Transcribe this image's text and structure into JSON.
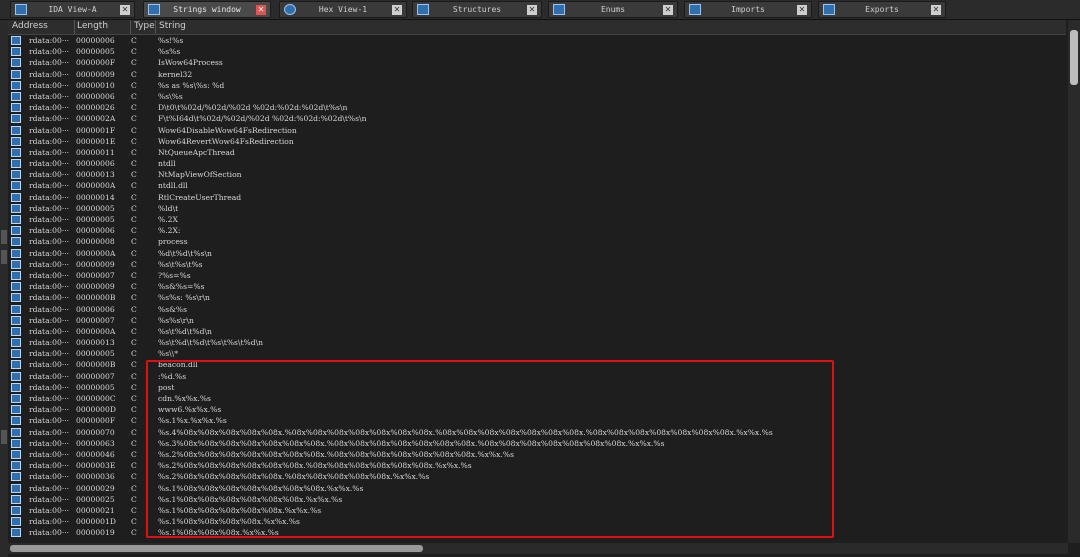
{
  "tabs": [
    {
      "label": "IDA View-A",
      "close": "✕",
      "active": false
    },
    {
      "label": "Strings window",
      "close": "✕",
      "active": true
    },
    {
      "label": "Hex View-1",
      "close": "✕",
      "active": false
    },
    {
      "label": "Structures",
      "close": "✕",
      "active": false
    },
    {
      "label": "Enums",
      "close": "✕",
      "active": false
    },
    {
      "label": "Imports",
      "close": "✕",
      "active": false
    },
    {
      "label": "Exports",
      "close": "✕",
      "active": false
    }
  ],
  "columns": {
    "address": "Address",
    "length": "Length",
    "type": "Type",
    "string": "String"
  },
  "rows": [
    {
      "address": "rdata:00···",
      "length": "00000006",
      "type": "C",
      "string": "%s!%s"
    },
    {
      "address": "rdata:00···",
      "length": "00000005",
      "type": "C",
      "string": "%s%s"
    },
    {
      "address": "rdata:00···",
      "length": "0000000F",
      "type": "C",
      "string": "IsWow64Process"
    },
    {
      "address": "rdata:00···",
      "length": "00000009",
      "type": "C",
      "string": "kernel32"
    },
    {
      "address": "rdata:00···",
      "length": "00000010",
      "type": "C",
      "string": "%s as %s\\%s: %d"
    },
    {
      "address": "rdata:00···",
      "length": "00000006",
      "type": "C",
      "string": "%s\\%s"
    },
    {
      "address": "rdata:00···",
      "length": "00000026",
      "type": "C",
      "string": "D\\t0\\t%02d/%02d/%02d %02d:%02d:%02d\\t%s\\n"
    },
    {
      "address": "rdata:00···",
      "length": "0000002A",
      "type": "C",
      "string": "F\\t%I64d\\t%02d/%02d/%02d %02d:%02d:%02d\\t%s\\n"
    },
    {
      "address": "rdata:00···",
      "length": "0000001F",
      "type": "C",
      "string": "Wow64DisableWow64FsRedirection"
    },
    {
      "address": "rdata:00···",
      "length": "0000001E",
      "type": "C",
      "string": "Wow64RevertWow64FsRedirection"
    },
    {
      "address": "rdata:00···",
      "length": "00000011",
      "type": "C",
      "string": "NtQueueApcThread"
    },
    {
      "address": "rdata:00···",
      "length": "00000006",
      "type": "C",
      "string": "ntdll"
    },
    {
      "address": "rdata:00···",
      "length": "00000013",
      "type": "C",
      "string": "NtMapViewOfSection"
    },
    {
      "address": "rdata:00···",
      "length": "0000000A",
      "type": "C",
      "string": "ntdll.dll"
    },
    {
      "address": "rdata:00···",
      "length": "00000014",
      "type": "C",
      "string": "RtlCreateUserThread"
    },
    {
      "address": "rdata:00···",
      "length": "00000005",
      "type": "C",
      "string": "%ld\\t"
    },
    {
      "address": "rdata:00···",
      "length": "00000005",
      "type": "C",
      "string": "%.2X"
    },
    {
      "address": "rdata:00···",
      "length": "00000006",
      "type": "C",
      "string": "%.2X:"
    },
    {
      "address": "rdata:00···",
      "length": "00000008",
      "type": "C",
      "string": "process"
    },
    {
      "address": "rdata:00···",
      "length": "0000000A",
      "type": "C",
      "string": "%d\\t%d\\t%s\\n"
    },
    {
      "address": "rdata:00···",
      "length": "00000009",
      "type": "C",
      "string": "%s\\t%s\\t%s"
    },
    {
      "address": "rdata:00···",
      "length": "00000007",
      "type": "C",
      "string": "?%s=%s"
    },
    {
      "address": "rdata:00···",
      "length": "00000009",
      "type": "C",
      "string": "%s&%s=%s"
    },
    {
      "address": "rdata:00···",
      "length": "0000000B",
      "type": "C",
      "string": "%s%s: %s\\r\\n"
    },
    {
      "address": "rdata:00···",
      "length": "00000006",
      "type": "C",
      "string": "%s&%s"
    },
    {
      "address": "rdata:00···",
      "length": "00000007",
      "type": "C",
      "string": "%s%s\\r\\n"
    },
    {
      "address": "rdata:00···",
      "length": "0000000A",
      "type": "C",
      "string": "%s\\t%d\\t%d\\n"
    },
    {
      "address": "rdata:00···",
      "length": "00000013",
      "type": "C",
      "string": "%s\\t%d\\t%d\\t%s\\t%s\\t%d\\n"
    },
    {
      "address": "rdata:00···",
      "length": "00000005",
      "type": "C",
      "string": "%s\\\\*"
    },
    {
      "address": "rdata:00···",
      "length": "0000000B",
      "type": "C",
      "string": "beacon.dll"
    },
    {
      "address": "rdata:00···",
      "length": "00000007",
      "type": "C",
      "string": ":%d.%s"
    },
    {
      "address": "rdata:00···",
      "length": "00000005",
      "type": "C",
      "string": "post"
    },
    {
      "address": "rdata:00···",
      "length": "0000000C",
      "type": "C",
      "string": "cdn.%x%x.%s"
    },
    {
      "address": "rdata:00···",
      "length": "0000000D",
      "type": "C",
      "string": "www6.%x%x.%s"
    },
    {
      "address": "rdata:00···",
      "length": "0000000F",
      "type": "C",
      "string": "%s.1%x.%x%x.%s"
    },
    {
      "address": "rdata:00···",
      "length": "00000070",
      "type": "C",
      "string": "%s.4%08x%08x%08x%08x%08x.%08x%08x%08x%08x%08x%08x%08x.%08x%08x%08x%08x%08x%08x%08x.%08x%08x%08x%08x%08x%08x%08x.%x%x.%s"
    },
    {
      "address": "rdata:00···",
      "length": "00000063",
      "type": "C",
      "string": "%s.3%08x%08x%08x%08x%08x%08x%08x.%08x%08x%08x%08x%08x%08x%08x.%08x%08x%08x%08x%08x%08x%08x.%x%x.%s"
    },
    {
      "address": "rdata:00···",
      "length": "00000046",
      "type": "C",
      "string": "%s.2%08x%08x%08x%08x%08x%08x%08x.%08x%08x%08x%08x%08x%08x%08x.%x%x.%s"
    },
    {
      "address": "rdata:00···",
      "length": "0000003E",
      "type": "C",
      "string": "%s.2%08x%08x%08x%08x%08x%08x.%08x%08x%08x%08x%08x%08x.%x%x.%s"
    },
    {
      "address": "rdata:00···",
      "length": "00000036",
      "type": "C",
      "string": "%s.2%08x%08x%08x%08x%08x.%08x%08x%08x%08x%08x.%x%x.%s"
    },
    {
      "address": "rdata:00···",
      "length": "00000029",
      "type": "C",
      "string": "%s.1%08x%08x%08x%08x%08x%08x%08x.%x%x.%s"
    },
    {
      "address": "rdata:00···",
      "length": "00000025",
      "type": "C",
      "string": "%s.1%08x%08x%08x%08x%08x%08x.%x%x.%s"
    },
    {
      "address": "rdata:00···",
      "length": "00000021",
      "type": "C",
      "string": "%s.1%08x%08x%08x%08x%08x.%x%x.%s"
    },
    {
      "address": "rdata:00···",
      "length": "0000001D",
      "type": "C",
      "string": "%s.1%08x%08x%08x%08x.%x%x.%s"
    },
    {
      "address": "rdata:00···",
      "length": "00000019",
      "type": "C",
      "string": "%s.1%08x%08x%08x.%x%x.%s"
    }
  ]
}
